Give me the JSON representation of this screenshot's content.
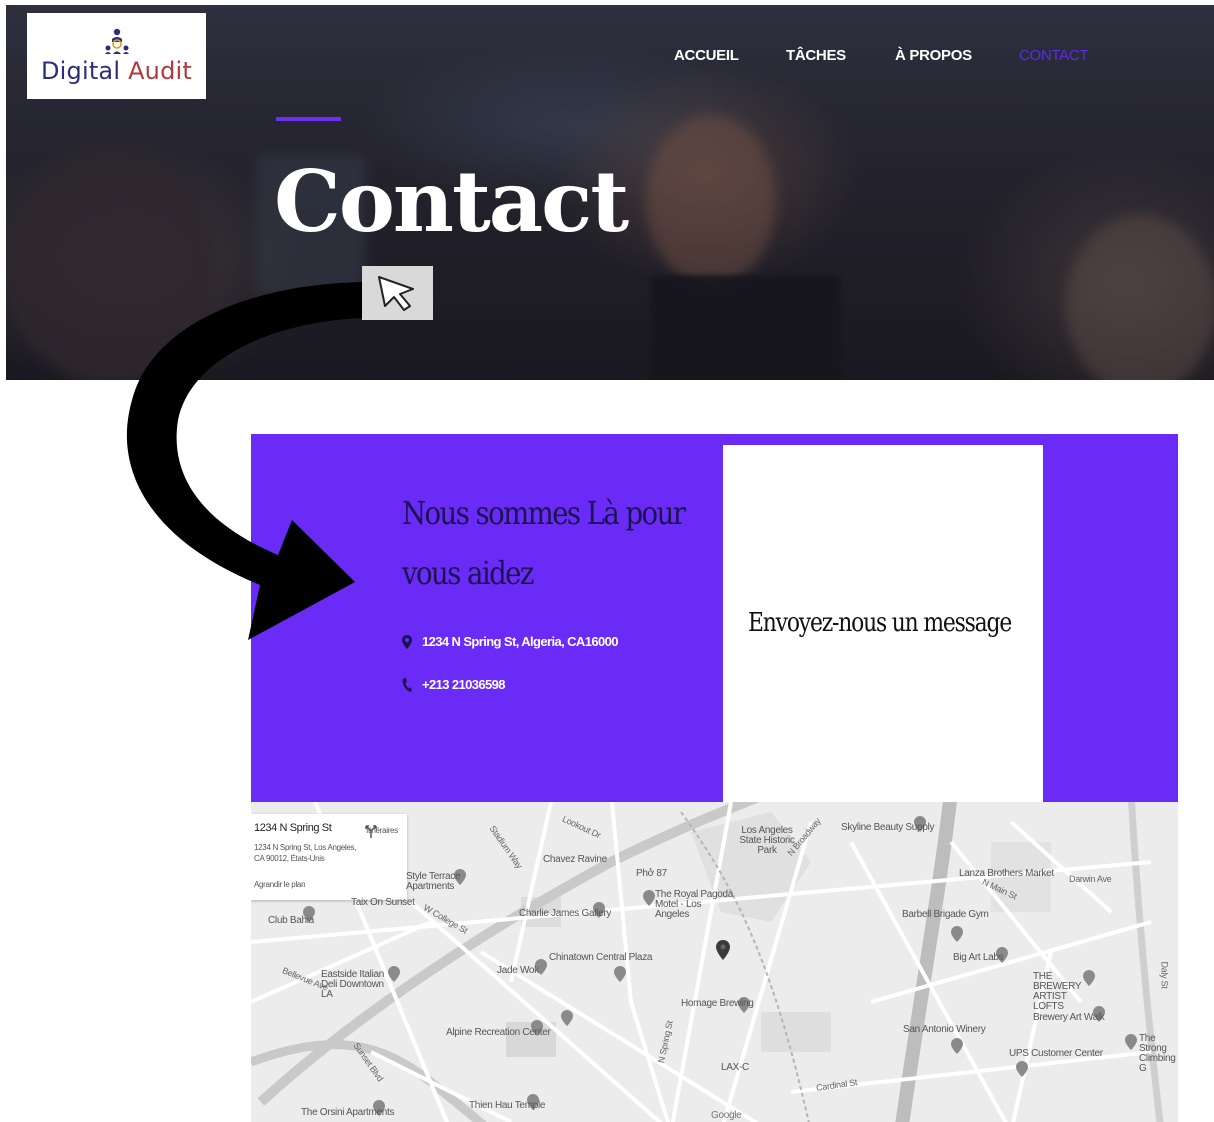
{
  "header": {
    "logo_text_1": "Digital",
    "logo_text_2": "Audit",
    "nav": [
      {
        "label": "ACCUEIL",
        "active": false
      },
      {
        "label": "TÂCHES",
        "active": false
      },
      {
        "label": "À PROPOS",
        "active": false
      },
      {
        "label": "CONTACT",
        "active": true
      }
    ]
  },
  "hero": {
    "title": "Contact"
  },
  "contact": {
    "heading_line1": "Nous sommes Là pour",
    "heading_line2": "vous aidez",
    "address": "1234 N Spring St, Algeria, CA16000",
    "phone": "+213 21036598",
    "message_title": "Envoyez-nous un message"
  },
  "map": {
    "info_title": "1234 N Spring St",
    "info_address": "1234 N Spring St, Los Angeles, CA 90012, États-Unis",
    "info_enlarge": "Agrandir le plan",
    "info_directions": "Itinéraires",
    "labels": {
      "l01": "Club Bahia",
      "l02": "Style Terrace Apartments",
      "l03": "Taix On Sunset",
      "l04": "Eastside Italian Deli Downtown LA",
      "l05": "Bellevue Ave",
      "l06": "W College St",
      "l07": "Jade Wok",
      "l08": "Chavez Ravine",
      "l09": "Charlie James Gallery",
      "l10": "Chinatown Central Plaza",
      "l11": "Phở 87",
      "l12": "The Royal Pagoda Motel - Los Angeles",
      "l13": "Los Angeles State Historic Park",
      "l14": "Skyline Beauty Supply",
      "l15": "Lanza Brothers Market",
      "l16": "N Main St",
      "l17": "Barbell Brigade Gym",
      "l18": "Big Art Labs",
      "l19": "THE BREWERY ARTIST LOFTS",
      "l20": "Brewery Art Walk",
      "l21": "Homage Brewing",
      "l22": "San Antonio Winery",
      "l23": "UPS Customer Center",
      "l24": "The Strong Climbing G",
      "l25": "Alpine Recreation Center",
      "l26": "LAX-C",
      "l27": "Cardinal St",
      "l28": "Thien Hau Temple",
      "l29": "The Orsini Apartments",
      "l30": "Sunset Blvd",
      "l31": "N Spring St",
      "l32": "Darwin Ave",
      "l33": "Daly St",
      "l34": "Google",
      "l35": "Stadium Way",
      "l36": "Lookout Dr",
      "l37": "N Broadway"
    }
  }
}
